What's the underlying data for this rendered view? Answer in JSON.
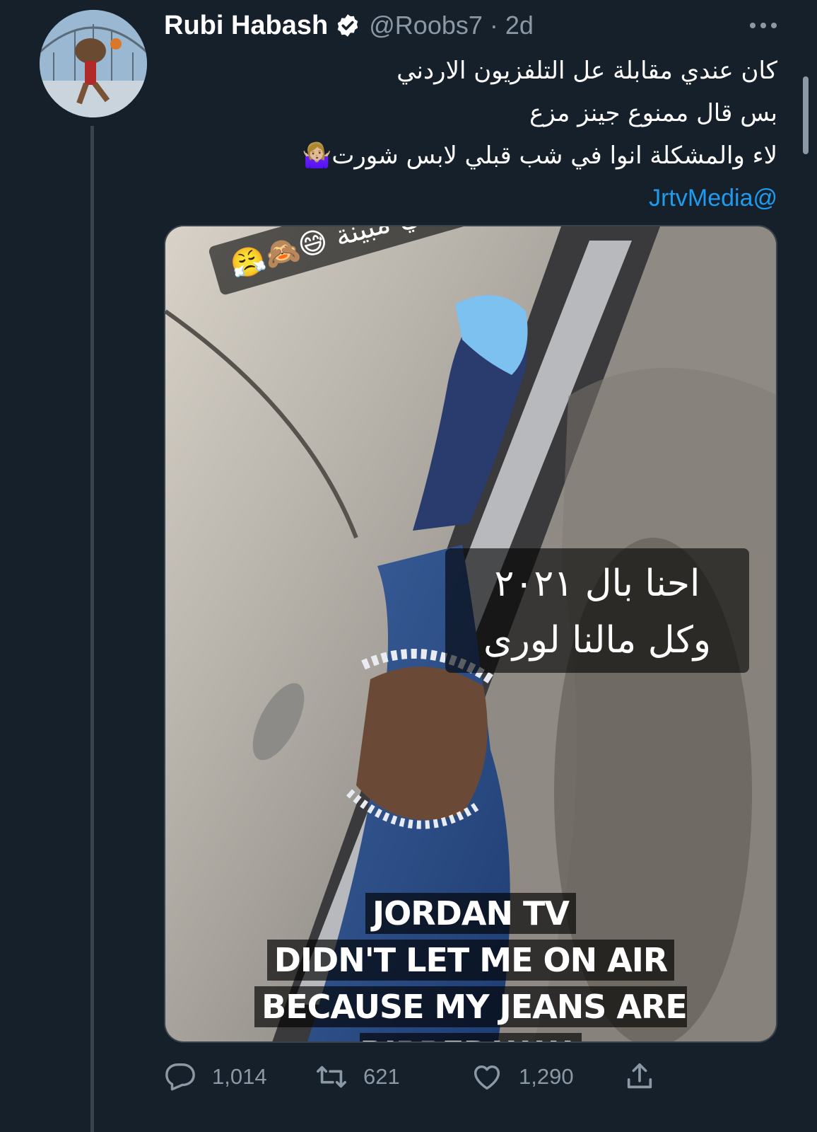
{
  "tweet": {
    "display_name": "Rubi Habash",
    "handle_time": "@Roobs7 · 2d",
    "lines": [
      "كان عندي مقابلة عل التلفزيون الاردني",
      "بس قال ممنوع جينز مزع",
      "لاء والمشكلة انوا في شب قبلي لابس شورت🤷🏼‍♀️"
    ],
    "mention": "@JrtvMedia"
  },
  "media": {
    "caption_top": "ركبتي مبينة 😅🙈😤",
    "caption_arabic_line1": "احنا بال ٢٠٢١",
    "caption_arabic_line2": "وكل مالنا لورى",
    "caption_en_line1": "JORDAN TV",
    "caption_en_line2": "DIDN'T LET ME ON AIR",
    "caption_en_line3": "BECAUSE MY JEANS ARE RIPPED!!!!!!"
  },
  "actions": {
    "reply_count": "1,014",
    "retweet_count": "621",
    "like_count": "1,290"
  },
  "icons": [
    "verified-badge-icon",
    "more-icon",
    "reply-icon",
    "retweet-icon",
    "like-icon",
    "share-icon"
  ],
  "colors": {
    "background": "#15202b",
    "link": "#1d9bf0",
    "muted": "#8b98a5",
    "border": "#38444d"
  }
}
